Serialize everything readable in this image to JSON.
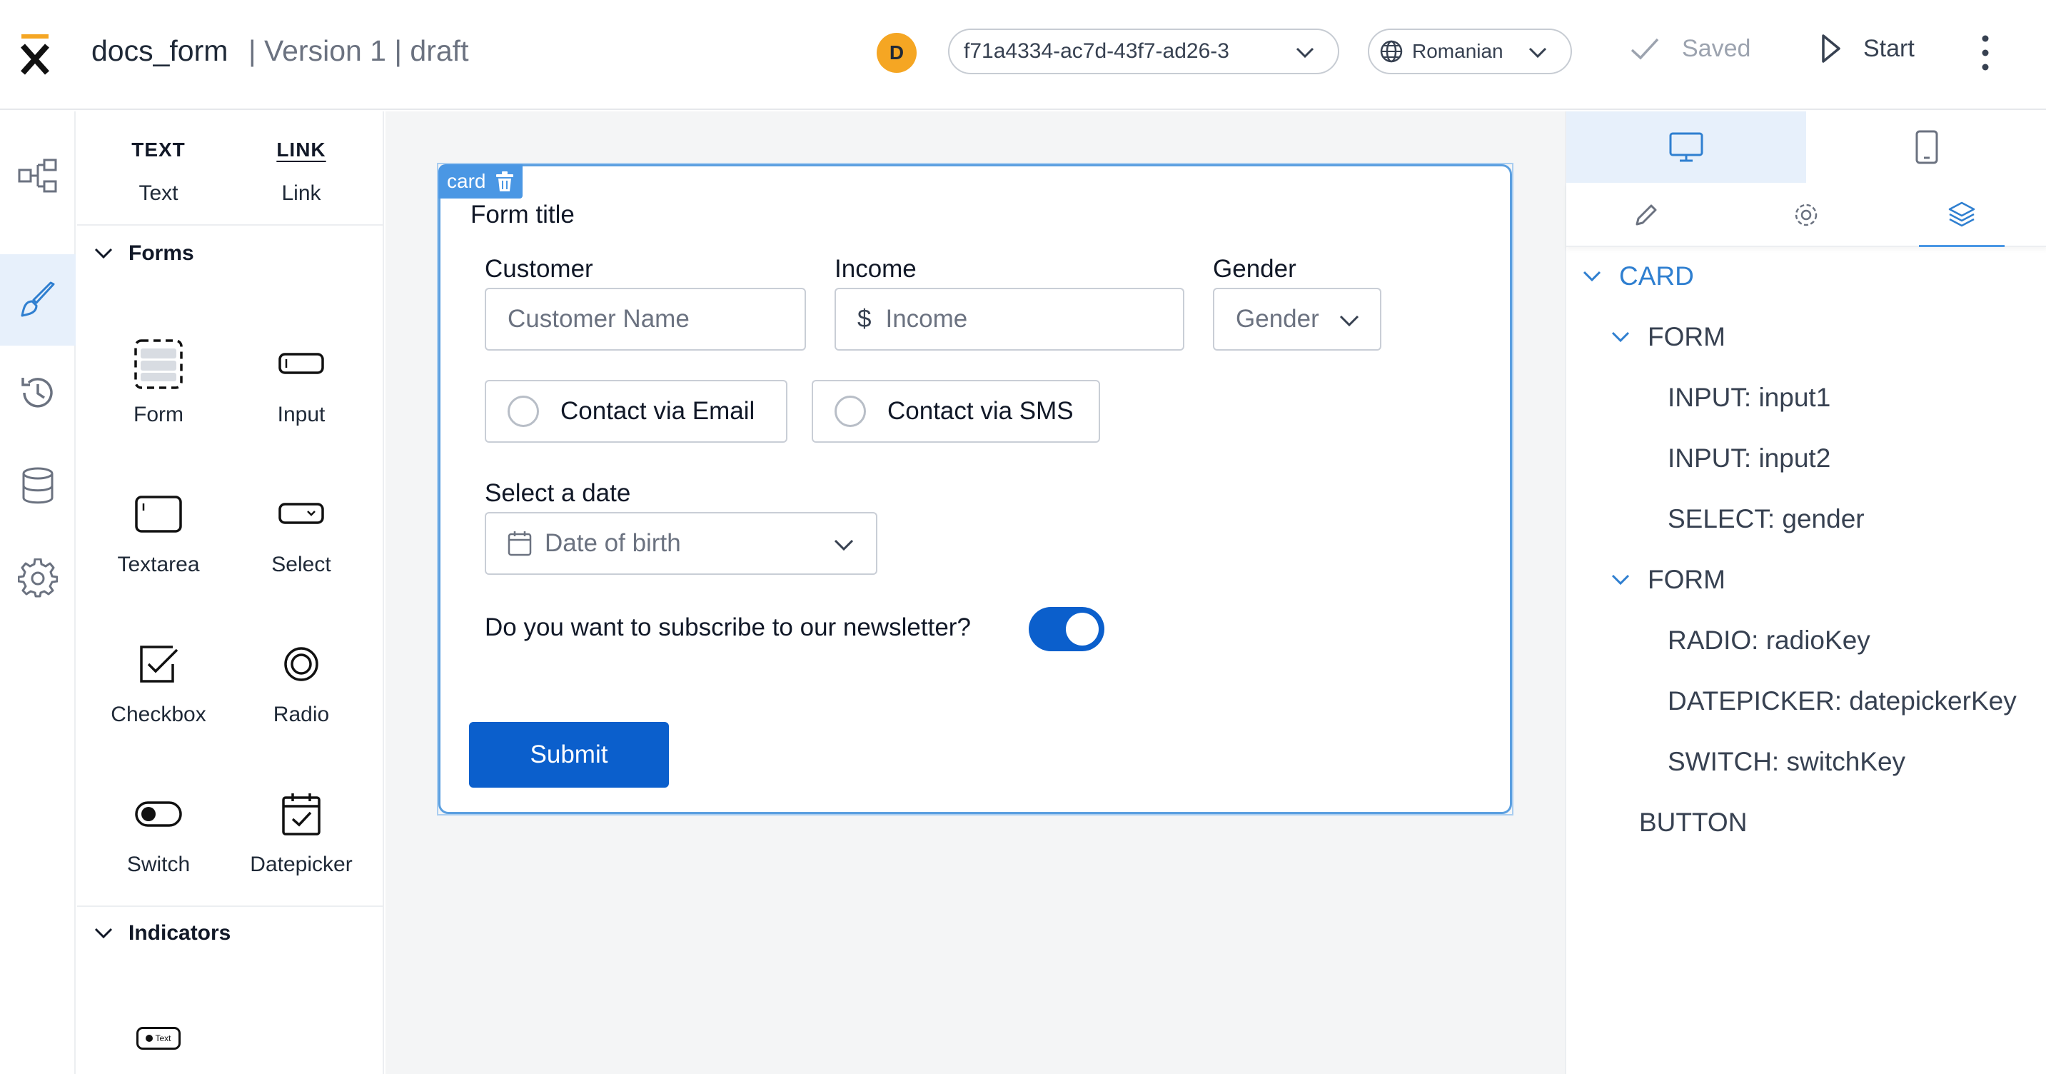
{
  "header": {
    "app_name": "docs_form",
    "version_info": "| Version 1 | draft",
    "avatar_initial": "D",
    "version_select": "f71a4334-ac7d-43f7-ad26-3",
    "language_select": "Romanian",
    "saved_label": "Saved",
    "start_label": "Start",
    "accent_color": "#f5a623"
  },
  "rail": {
    "items": [
      "process-flow-icon",
      "brush-icon",
      "history-icon",
      "database-icon",
      "gear-icon"
    ],
    "active": "brush-icon"
  },
  "palette": {
    "top_items": [
      {
        "icon_text": "TEXT",
        "label": "Text"
      },
      {
        "icon_text": "LINK",
        "label": "Link"
      }
    ],
    "forms_section": "Forms",
    "forms_items": [
      {
        "label": "Form",
        "icon": "form-icon"
      },
      {
        "label": "Input",
        "icon": "input-icon"
      },
      {
        "label": "Textarea",
        "icon": "textarea-icon"
      },
      {
        "label": "Select",
        "icon": "select-icon"
      },
      {
        "label": "Checkbox",
        "icon": "checkbox-icon"
      },
      {
        "label": "Radio",
        "icon": "radio-icon"
      },
      {
        "label": "Switch",
        "icon": "switch-icon"
      },
      {
        "label": "Datepicker",
        "icon": "datepicker-icon"
      }
    ],
    "indicators_section": "Indicators",
    "indicator_item_text": "Text"
  },
  "canvas": {
    "card_tag": "card",
    "form_title": "Form title",
    "customer_label": "Customer",
    "customer_placeholder": "Customer Name",
    "income_label": "Income",
    "income_prefix": "$",
    "income_placeholder": "Income",
    "gender_label": "Gender",
    "gender_placeholder": "Gender",
    "radio_email": "Contact via Email",
    "radio_sms": "Contact via SMS",
    "date_label": "Select a date",
    "date_placeholder": "Date of birth",
    "newsletter_question": "Do you want to subscribe to our newsletter?",
    "newsletter_on": true,
    "submit_label": "Submit",
    "primary_color": "#0b5fcc"
  },
  "right_panel": {
    "device_tabs": [
      "desktop-icon",
      "mobile-icon"
    ],
    "active_device": "desktop-icon",
    "prop_tabs": [
      "pencil-icon",
      "gear-icon",
      "layers-icon"
    ],
    "active_prop_tab": "layers-icon",
    "tree": [
      {
        "label": "CARD",
        "level": 0,
        "expandable": true
      },
      {
        "label": "FORM",
        "level": 1,
        "expandable": true
      },
      {
        "label": "INPUT: input1",
        "level": 2,
        "expandable": false
      },
      {
        "label": "INPUT: input2",
        "level": 2,
        "expandable": false
      },
      {
        "label": "SELECT: gender",
        "level": 2,
        "expandable": false
      },
      {
        "label": "FORM",
        "level": 1,
        "expandable": true
      },
      {
        "label": "RADIO: radioKey",
        "level": 2,
        "expandable": false
      },
      {
        "label": "DATEPICKER: datepickerKey",
        "level": 2,
        "expandable": false
      },
      {
        "label": "SWITCH: switchKey",
        "level": 2,
        "expandable": false
      },
      {
        "label": "BUTTON",
        "level": 1,
        "expandable": false
      }
    ]
  }
}
